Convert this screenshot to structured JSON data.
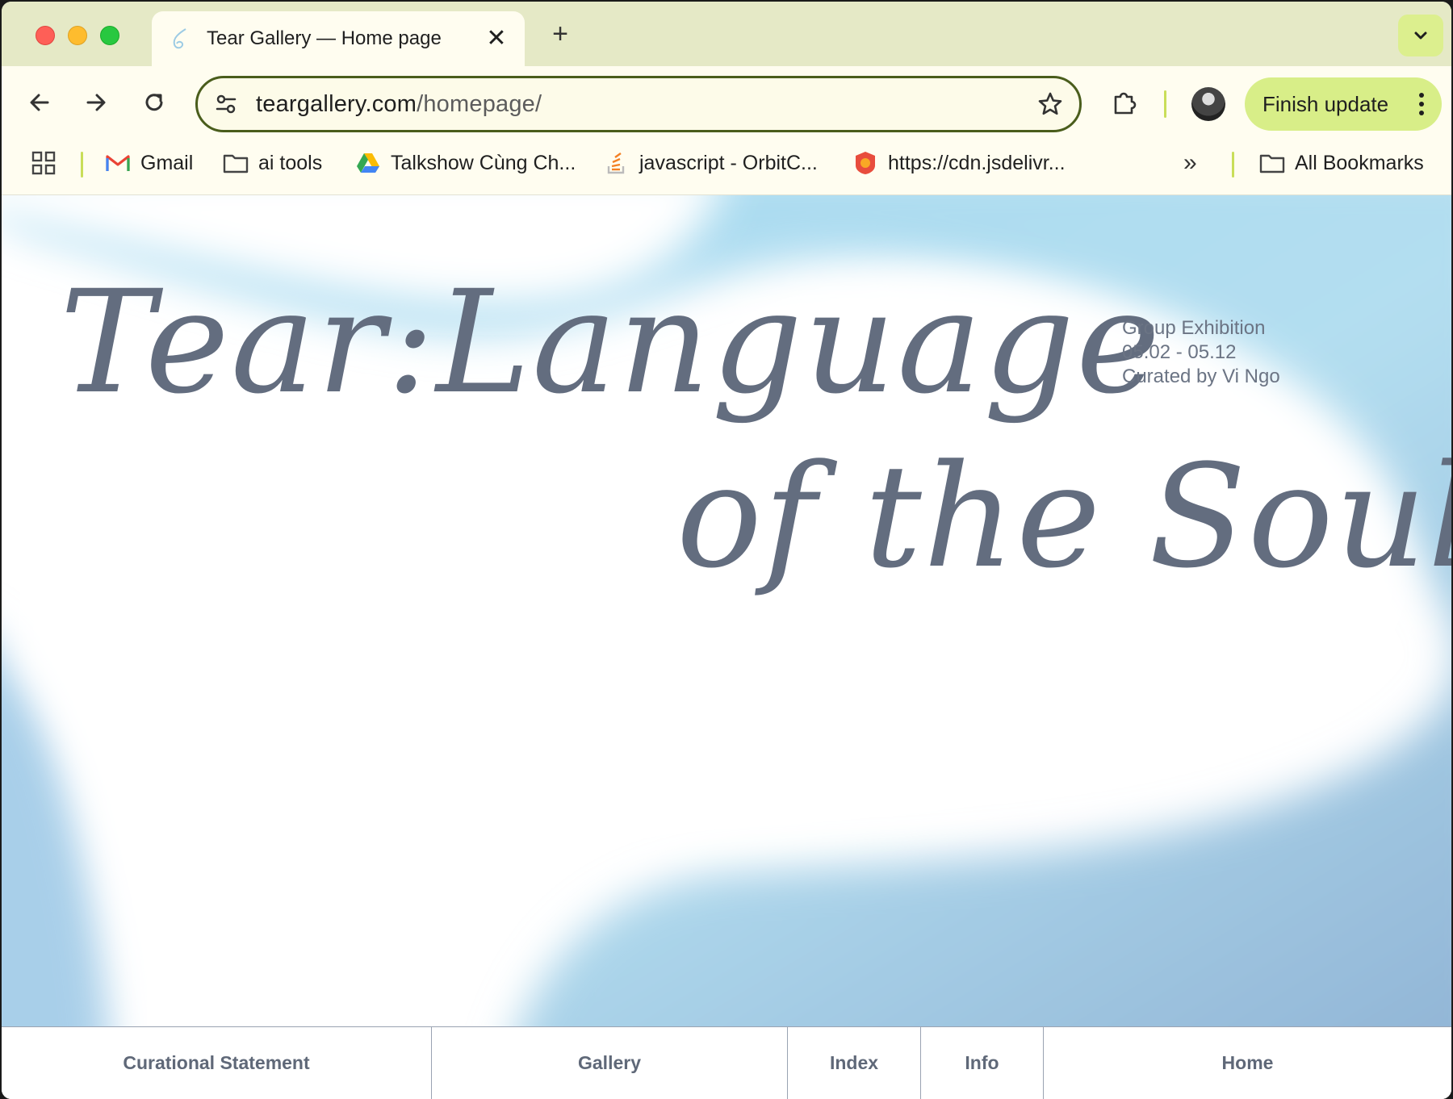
{
  "browser": {
    "tab_title": "Tear Gallery — Home page",
    "url_host": "teargallery.com",
    "url_path": "/homepage/",
    "finish_update_label": "Finish update"
  },
  "bookmarks": [
    {
      "label": "Gmail",
      "icon": "gmail-icon"
    },
    {
      "label": "ai tools",
      "icon": "folder-icon"
    },
    {
      "label": "Talkshow Cùng Ch...",
      "icon": "google-drive-icon"
    },
    {
      "label": "javascript - OrbitC...",
      "icon": "stackoverflow-icon"
    },
    {
      "label": "https://cdn.jsdelivr...",
      "icon": "jsdelivr-icon"
    }
  ],
  "all_bookmarks_label": "All Bookmarks",
  "hero": {
    "title_line1": "Tear:Language",
    "title_line2": "of the Soul"
  },
  "exhibition": {
    "type": "Group Exhibition",
    "dates": "05.02 - 05.12",
    "curator": "Curated by Vi Ngo"
  },
  "nav": [
    {
      "label": "Curational Statement"
    },
    {
      "label": "Gallery"
    },
    {
      "label": "Index"
    },
    {
      "label": "Info"
    },
    {
      "label": "Home"
    }
  ],
  "colors": {
    "title": "#636d7f",
    "blob_light": "#a9dcf0",
    "blob_deep": "#8fb8d8",
    "browser_accent": "#d8ee88"
  }
}
